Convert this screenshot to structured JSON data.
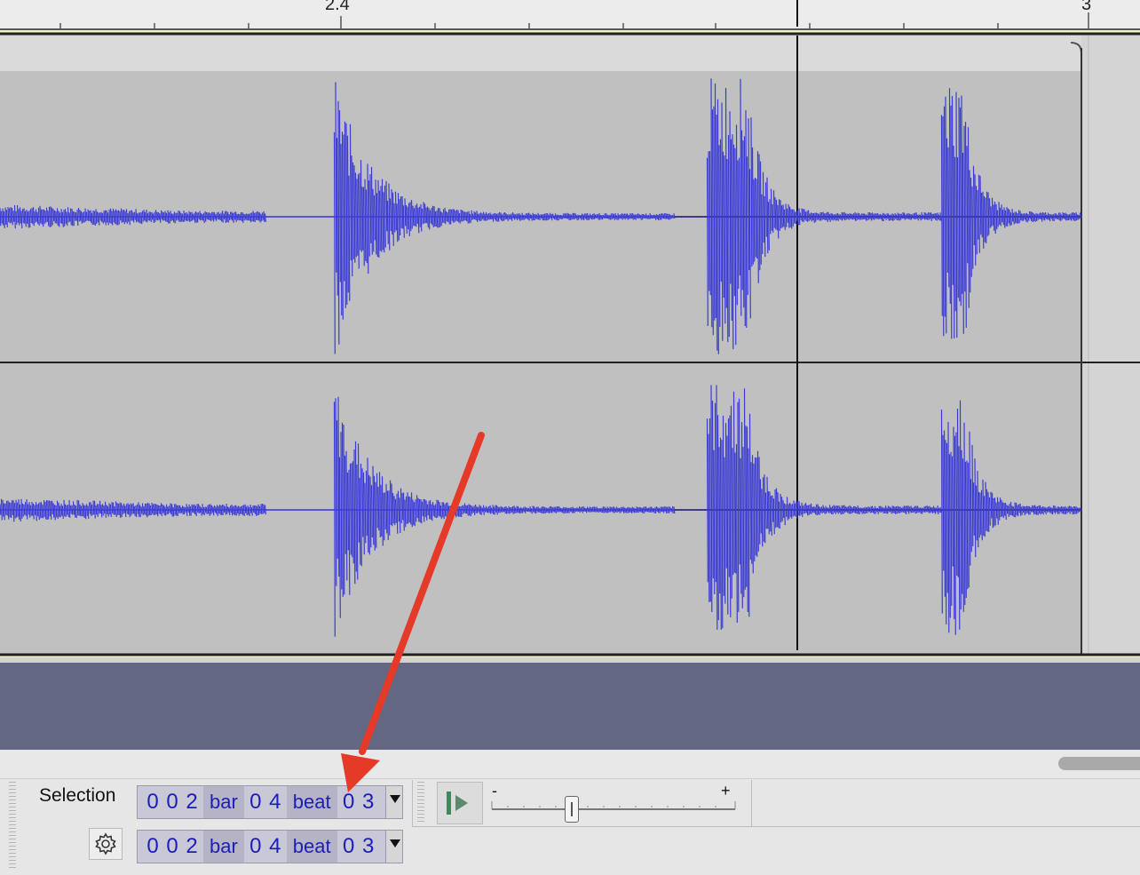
{
  "ruler": {
    "labels": [
      {
        "text": "2.4"
      },
      {
        "text": "3"
      }
    ]
  },
  "toolbar": {
    "selection_label": "Selection",
    "start_time": {
      "bars": [
        "0",
        "0",
        "2"
      ],
      "bar_unit": "bar",
      "beats": [
        "0",
        "4"
      ],
      "beat_unit": "beat",
      "sub": [
        "0",
        "3"
      ]
    },
    "end_time": {
      "bars": [
        "0",
        "0",
        "2"
      ],
      "bar_unit": "bar",
      "beats": [
        "0",
        "4"
      ],
      "beat_unit": "beat",
      "sub": [
        "0",
        "3"
      ]
    },
    "speed_slider": {
      "min_label": "-",
      "max_label": "+",
      "value": 0.33
    }
  },
  "colors": {
    "waveform": "#3b3bd6",
    "track_bg": "#c0c0c0",
    "empty_area": "#636783",
    "annotation_arrow": "#e53a28"
  },
  "icons": [
    "gear-icon",
    "play-at-speed-icon",
    "dropdown-arrow-icon"
  ]
}
